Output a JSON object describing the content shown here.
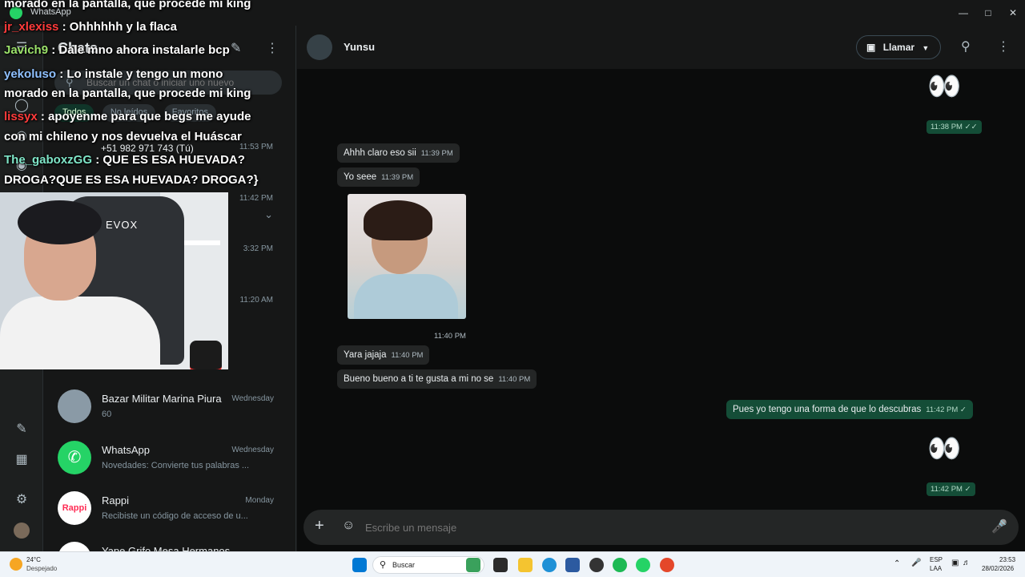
{
  "titlebar": {
    "title": "WhatsApp"
  },
  "sidebar": {
    "title": "Chats"
  },
  "search": {
    "placeholder": "Buscar un chat o iniciar uno nuevo"
  },
  "filters": [
    "Todos",
    "No leídos",
    "Favoritos"
  ],
  "list_partial": {
    "self_contact": "+51 982 971 743 (Tú)",
    "times": [
      "11:53 PM",
      "11:42 PM",
      "3:32 PM",
      "11:20 AM"
    ]
  },
  "chats": [
    {
      "name": "Bazar Militar Marina Piura",
      "when": "Wednesday",
      "preview": "60",
      "avatar_color": "#8a9aa6"
    },
    {
      "name": "WhatsApp",
      "when": "Wednesday",
      "preview": "Novedades: Convierte tus palabras ...",
      "avatar_color": "#25d366"
    },
    {
      "name": "Rappi",
      "when": "Monday",
      "preview": "Recibiste un código de acceso de u...",
      "avatar_color": "#ffffff"
    },
    {
      "name": "Yape Grifo Mesa Hermanos",
      "when": "",
      "preview": "",
      "avatar_color": "#ffffff"
    }
  ],
  "conversation": {
    "contact_name": "Yunsu",
    "call_label": "Llamar",
    "messages": [
      {
        "dir": "out",
        "text": "👀",
        "time": "11:38 PM"
      },
      {
        "dir": "in",
        "text": "Ahhh claro eso sii",
        "time": "11:39 PM"
      },
      {
        "dir": "in",
        "text": "Yo seee",
        "time": "11:39 PM"
      },
      {
        "dir": "in",
        "text": "[image]",
        "time": "11:40 PM"
      },
      {
        "dir": "in",
        "text": "Yara jajaja",
        "time": "11:40 PM"
      },
      {
        "dir": "in",
        "text": "Bueno bueno a ti te gusta a mi no se",
        "time": "11:40 PM"
      },
      {
        "dir": "out",
        "text": "Pues yo tengo una forma de que lo descubras",
        "time": "11:42 PM"
      },
      {
        "dir": "out",
        "text": "👀",
        "time": "11:42 PM"
      }
    ],
    "composer_placeholder": "Escribe un mensaje"
  },
  "stream_chat": [
    {
      "user": "",
      "text": "morado en la pantalla, que procede mi king",
      "color": "#ffffff"
    },
    {
      "user": "jr_xlexiss",
      "text": ": Ohhhhhh y la flaca",
      "color": "#ff3b3b"
    },
    {
      "user": "Javich9",
      "text": ": Dale mno ahora instalarle bcp",
      "color": "#9be26a"
    },
    {
      "user": "yekoluso",
      "text": ": Lo instale y tengo un mono",
      "color": "#8fc0ff"
    },
    {
      "user": "",
      "text": "morado en la pantalla, que procede mi king",
      "color": "#ffffff"
    },
    {
      "user": "lissyx",
      "text": ": apoyenme para que begs me ayude",
      "color": "#ff3b3b"
    },
    {
      "user": "",
      "text": "con mi chileno y nos devuelva el Huáscar",
      "color": "#ffffff"
    },
    {
      "user": "The_gaboxzGG",
      "text": ": QUE ES ESA HUEVADA?",
      "color": "#7fe6c8"
    },
    {
      "user": "",
      "text": "DROGA?QUE ES ESA HUEVADA? DROGA?}",
      "color": "#ffffff"
    }
  ],
  "webcam": {
    "brand": "EVOX"
  },
  "taskbar": {
    "temp": "24°C",
    "condition": "Despejado",
    "search_label": "Buscar",
    "lang1": "ESP",
    "lang2": "LAA",
    "clock_time": "23:53",
    "clock_date": "28/02/2026"
  }
}
